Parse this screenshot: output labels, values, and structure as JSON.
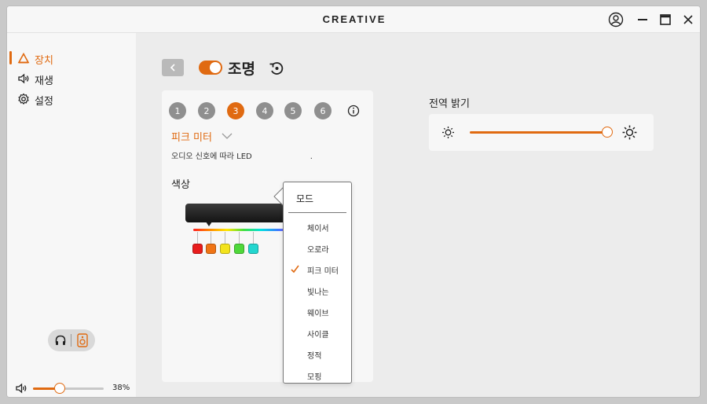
{
  "app": {
    "brand": "CREATIVE"
  },
  "sidebar": {
    "items": [
      {
        "label": "장치",
        "icon": "speaker-triangle-icon",
        "active": true
      },
      {
        "label": "재생",
        "icon": "volume-icon",
        "active": false
      },
      {
        "label": "설정",
        "icon": "gear-icon",
        "active": false
      }
    ],
    "output_toggle": {
      "left_icon": "headphones-icon",
      "right_icon": "speaker-icon"
    },
    "volume": {
      "value": 38,
      "text": "38%"
    }
  },
  "main": {
    "title": "조명",
    "lighting_on": true,
    "zones": [
      {
        "label": "1",
        "active": false
      },
      {
        "label": "2",
        "active": false
      },
      {
        "label": "3",
        "active": true
      },
      {
        "label": "4",
        "active": false
      },
      {
        "label": "5",
        "active": false
      },
      {
        "label": "6",
        "active": false
      }
    ],
    "selected_mode": "피크 미터",
    "description": "오디오 신호에 따라 LED",
    "description_tail": ".",
    "color_heading": "색상",
    "swatches": [
      "#e81c1c",
      "#f07415",
      "#f3e31c",
      "#4fd83a",
      "#23d6cf"
    ],
    "dropdown": {
      "header": "모드",
      "items": [
        {
          "label": "체이서",
          "selected": false
        },
        {
          "label": "오로라",
          "selected": false
        },
        {
          "label": "피크 미터",
          "selected": true
        },
        {
          "label": "빛나는",
          "selected": false
        },
        {
          "label": "웨이브",
          "selected": false
        },
        {
          "label": "사이클",
          "selected": false
        },
        {
          "label": "정적",
          "selected": false
        },
        {
          "label": "모핑",
          "selected": false
        }
      ]
    },
    "brightness": {
      "label": "전역 밝기",
      "value": 100
    }
  },
  "colors": {
    "accent": "#e06a11",
    "panel": "#f7f7f7",
    "background": "#ececec"
  }
}
